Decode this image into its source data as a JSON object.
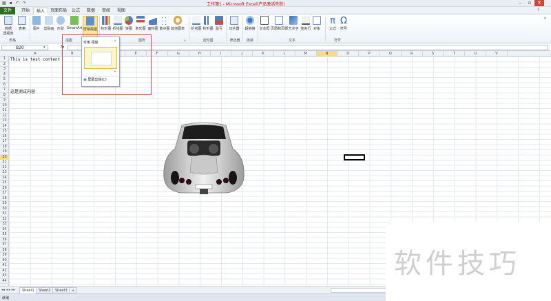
{
  "window": {
    "title": "工作簿1 - Microsoft Excel(产品激活失败)",
    "controls": [
      "minimize-icon",
      "restore-icon",
      "close-icon"
    ]
  },
  "tabs": [
    {
      "label": "文件"
    },
    {
      "label": "开始"
    },
    {
      "label": "插入"
    },
    {
      "label": "页面布局"
    },
    {
      "label": "公式"
    },
    {
      "label": "数据"
    },
    {
      "label": "审阅"
    },
    {
      "label": "视图"
    }
  ],
  "ribbon": {
    "buttons": [
      {
        "label": "数据\n透视表",
        "icon": "pivot-icon"
      },
      {
        "label": "表格",
        "icon": "table-icon"
      },
      {
        "label": "图片",
        "icon": "picture-icon"
      },
      {
        "label": "剪贴画",
        "icon": "clipart-icon"
      },
      {
        "label": "形状",
        "icon": "shapes-icon"
      },
      {
        "label": "SmartArt",
        "icon": "smartart-icon"
      },
      {
        "label": "屏幕截图",
        "icon": "screenshot-icon"
      },
      {
        "label": "柱形图",
        "icon": "column-chart-icon"
      },
      {
        "label": "折线图",
        "icon": "line-chart-icon"
      },
      {
        "label": "饼图",
        "icon": "pie-chart-icon"
      },
      {
        "label": "条形图",
        "icon": "bar-chart-icon"
      },
      {
        "label": "面积图",
        "icon": "area-chart-icon"
      },
      {
        "label": "散点图",
        "icon": "scatter-chart-icon"
      },
      {
        "label": "其他图表",
        "icon": "other-chart-icon"
      },
      {
        "label": "折线图",
        "icon": "sparkline-line-icon"
      },
      {
        "label": "柱形图",
        "icon": "sparkline-column-icon"
      },
      {
        "label": "盈亏",
        "icon": "sparkline-winloss-icon"
      },
      {
        "label": "切片器",
        "icon": "slicer-icon"
      },
      {
        "label": "超链接",
        "icon": "hyperlink-icon"
      },
      {
        "label": "文本框",
        "icon": "textbox-icon"
      },
      {
        "label": "页眉和页脚",
        "icon": "header-footer-icon"
      },
      {
        "label": "艺术字",
        "icon": "wordart-icon"
      },
      {
        "label": "签名行",
        "icon": "signature-icon"
      },
      {
        "label": "对象",
        "icon": "object-icon"
      },
      {
        "label": "公式",
        "icon": "equation-icon"
      },
      {
        "label": "符号",
        "icon": "symbol-icon"
      }
    ],
    "groups": [
      {
        "label": "表格"
      },
      {
        "label": "插图"
      },
      {
        "label": "图表"
      },
      {
        "label": "迷你图"
      },
      {
        "label": "筛选器"
      },
      {
        "label": "链接"
      },
      {
        "label": "文本"
      },
      {
        "label": "符号"
      }
    ]
  },
  "formula_bar": {
    "name_box": "B20",
    "fx": "fx",
    "value": ""
  },
  "dropdown": {
    "header": "可用 视窗",
    "clip_label": "屏幕剪辑(C)"
  },
  "columns": [
    "A",
    "B",
    "C",
    "D",
    "E",
    "F",
    "G",
    "H",
    "I",
    "J",
    "K",
    "L",
    "M",
    "N",
    "O",
    "P",
    "Q",
    "R",
    "S",
    "T",
    "U",
    "V"
  ],
  "selected_column": "N",
  "rows": [
    "1",
    "2",
    "3",
    "4",
    "5",
    "6",
    "7",
    "8",
    "9",
    "10",
    "11",
    "12",
    "13",
    "14",
    "15",
    "16",
    "17",
    "18",
    "19",
    "20",
    "21",
    "22",
    "23",
    "24",
    "25",
    "26",
    "27",
    "28",
    "29",
    "30",
    "31",
    "32",
    "33",
    "34",
    "35",
    "36",
    "37",
    "38",
    "39",
    "40",
    "41",
    "42",
    "43",
    "44"
  ],
  "selected_row": "20",
  "cells": {
    "a1": "This is test content",
    "a7": "这是测试内容"
  },
  "sheets": [
    {
      "label": "Sheet1"
    },
    {
      "label": "Sheet2"
    },
    {
      "label": "Sheet3"
    }
  ],
  "status": "就绪",
  "watermark": "软件技巧"
}
